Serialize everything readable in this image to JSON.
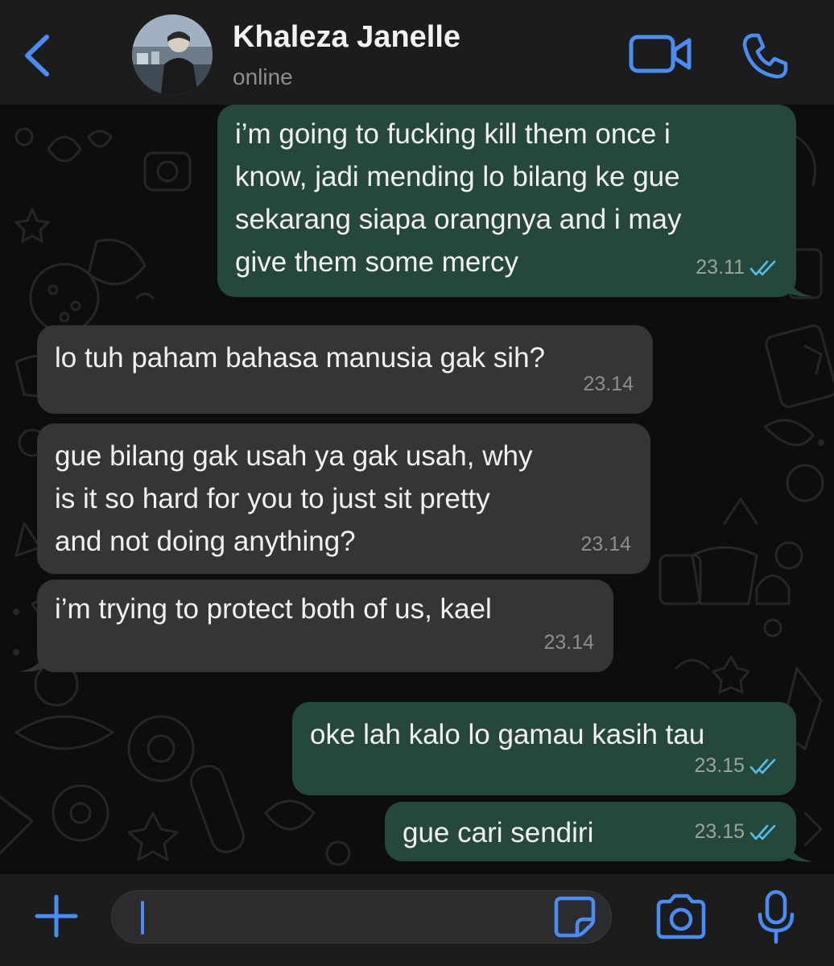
{
  "header": {
    "back_icon": "chevron-left-icon",
    "contact_name": "Khaleza Janelle",
    "status": "online",
    "video_icon": "video-camera-icon",
    "phone_icon": "phone-icon"
  },
  "colors": {
    "accent": "#4a8cf5",
    "outgoing_bubble": "#25483a",
    "incoming_bubble": "#353535",
    "read_tick": "#53bdeb"
  },
  "messages": [
    {
      "direction": "outgoing",
      "text": "i’m going to fucking kill them once i\nknow, jadi mending lo bilang ke gue\nsekarang siapa orangnya and i may\ngive them some mercy",
      "time": "23.11",
      "status": "read"
    },
    {
      "direction": "incoming",
      "text": "lo tuh paham bahasa manusia gak sih?",
      "time": "23.14"
    },
    {
      "direction": "incoming",
      "text": "gue bilang gak usah ya gak usah, why\nis it so hard for you to just sit pretty\nand not doing anything?",
      "time": "23.14"
    },
    {
      "direction": "incoming",
      "text": "i’m trying to protect both of us, kael",
      "time": "23.14"
    },
    {
      "direction": "outgoing",
      "text": "oke lah kalo lo gamau kasih tau",
      "time": "23.15",
      "status": "read"
    },
    {
      "direction": "outgoing",
      "text": "gue cari sendiri",
      "time": "23.15",
      "status": "read"
    }
  ],
  "input_bar": {
    "plus_icon": "plus-icon",
    "message_value": "",
    "sticker_icon": "sticker-icon",
    "camera_icon": "camera-icon",
    "mic_icon": "microphone-icon"
  }
}
